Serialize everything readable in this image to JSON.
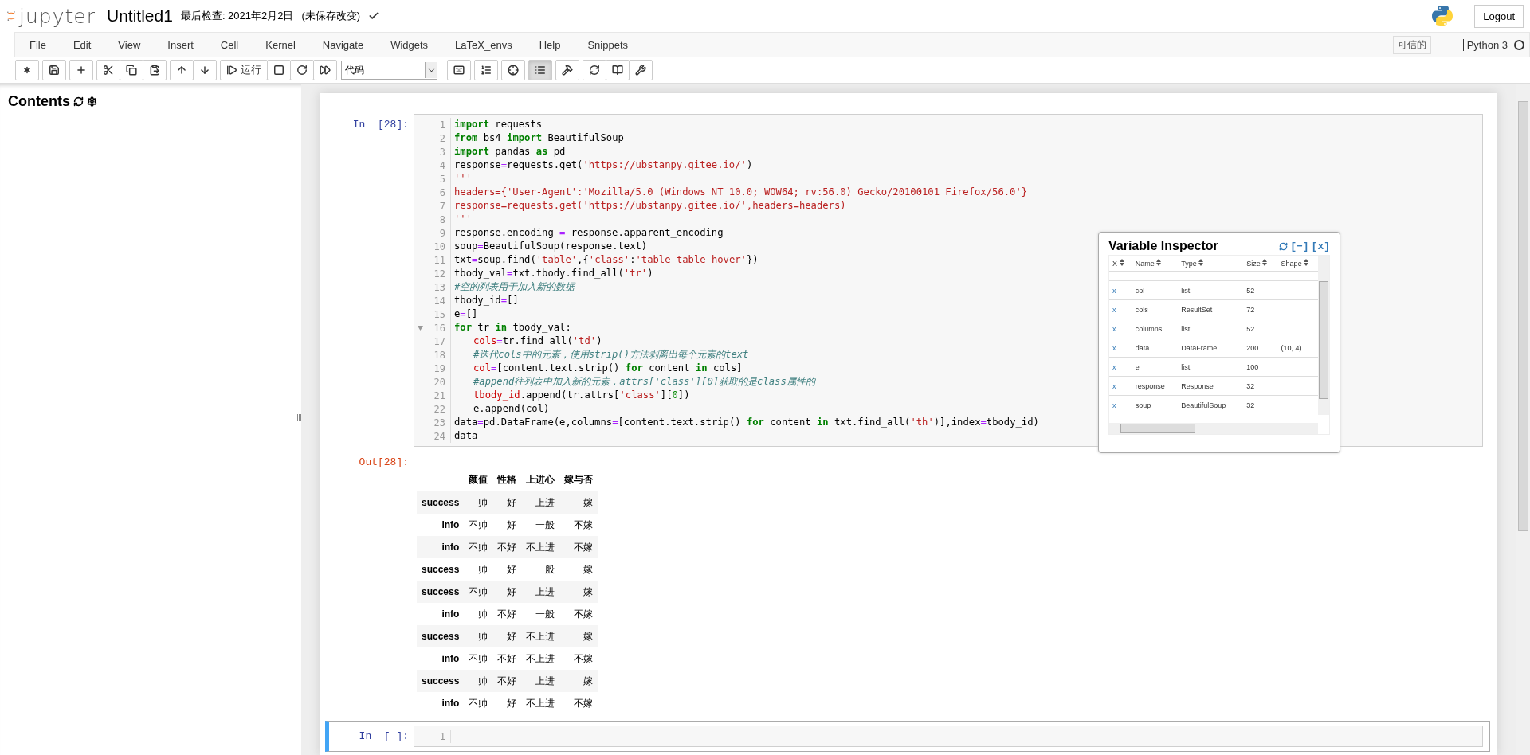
{
  "header": {
    "logo_text": "jupyter",
    "notebook_name": "Untitled1",
    "checkpoint": "最后检查: 2021年2月2日",
    "save_status": "(未保存改变)",
    "saved_mark": true,
    "logout": "Logout"
  },
  "menubar": {
    "items": [
      "File",
      "Edit",
      "View",
      "Insert",
      "Cell",
      "Kernel",
      "Navigate",
      "Widgets",
      "LaTeX_envs",
      "Help",
      "Snippets"
    ],
    "trusted": "可信的",
    "kernel": "Python 3",
    "kernel_busy": false
  },
  "toolbar": {
    "run_label": "运行",
    "cell_type": "代码",
    "toc_button_pressed": true
  },
  "sidebar": {
    "title": "Contents"
  },
  "cells": [
    {
      "prompt": "In  [28]:",
      "selected": false,
      "lines": [
        {
          "number": "1",
          "foldable": false,
          "tokens": [
            {
              "kind": "kw",
              "text": "import"
            },
            {
              "kind": "plain",
              "text": " requests"
            }
          ]
        },
        {
          "number": "2",
          "foldable": false,
          "tokens": [
            {
              "kind": "kw",
              "text": "from"
            },
            {
              "kind": "plain",
              "text": " bs4 "
            },
            {
              "kind": "kw",
              "text": "import"
            },
            {
              "kind": "plain",
              "text": " BeautifulSoup"
            }
          ]
        },
        {
          "number": "3",
          "foldable": false,
          "tokens": [
            {
              "kind": "kw",
              "text": "import"
            },
            {
              "kind": "plain",
              "text": " pandas "
            },
            {
              "kind": "kw",
              "text": "as"
            },
            {
              "kind": "plain",
              "text": " pd"
            }
          ]
        },
        {
          "number": "4",
          "foldable": false,
          "tokens": [
            {
              "kind": "plain",
              "text": "response"
            },
            {
              "kind": "op",
              "text": "="
            },
            {
              "kind": "plain",
              "text": "requests.get("
            },
            {
              "kind": "str",
              "text": "'https://ubstanpy.gitee.io/'"
            },
            {
              "kind": "plain",
              "text": ")"
            }
          ]
        },
        {
          "number": "5",
          "foldable": false,
          "tokens": [
            {
              "kind": "str",
              "text": "'''"
            }
          ]
        },
        {
          "number": "6",
          "foldable": false,
          "tokens": [
            {
              "kind": "str",
              "text": "headers={'User-Agent':'Mozilla/5.0 (Windows NT 10.0; WOW64; rv:56.0) Gecko/20100101 Firefox/56.0'}"
            }
          ]
        },
        {
          "number": "7",
          "foldable": false,
          "tokens": [
            {
              "kind": "str",
              "text": "response=requests.get('https://ubstanpy.gitee.io/',headers=headers)"
            }
          ]
        },
        {
          "number": "8",
          "foldable": false,
          "tokens": [
            {
              "kind": "str",
              "text": "'''"
            }
          ]
        },
        {
          "number": "9",
          "foldable": false,
          "tokens": [
            {
              "kind": "plain",
              "text": "response.encoding "
            },
            {
              "kind": "op",
              "text": "="
            },
            {
              "kind": "plain",
              "text": " response.apparent_encoding"
            }
          ]
        },
        {
          "number": "10",
          "foldable": false,
          "tokens": [
            {
              "kind": "plain",
              "text": "soup"
            },
            {
              "kind": "op",
              "text": "="
            },
            {
              "kind": "plain",
              "text": "BeautifulSoup(response.text)"
            }
          ]
        },
        {
          "number": "11",
          "foldable": false,
          "tokens": [
            {
              "kind": "plain",
              "text": "txt"
            },
            {
              "kind": "op",
              "text": "="
            },
            {
              "kind": "plain",
              "text": "soup.find("
            },
            {
              "kind": "str",
              "text": "'table'"
            },
            {
              "kind": "plain",
              "text": ",{"
            },
            {
              "kind": "str",
              "text": "'class'"
            },
            {
              "kind": "plain",
              "text": ":"
            },
            {
              "kind": "str",
              "text": "'table table-hover'"
            },
            {
              "kind": "plain",
              "text": "})"
            }
          ]
        },
        {
          "number": "12",
          "foldable": false,
          "tokens": [
            {
              "kind": "plain",
              "text": "tbody_val"
            },
            {
              "kind": "op",
              "text": "="
            },
            {
              "kind": "plain",
              "text": "txt.tbody.find_all("
            },
            {
              "kind": "str",
              "text": "'tr'"
            },
            {
              "kind": "plain",
              "text": ")"
            }
          ]
        },
        {
          "number": "13",
          "foldable": false,
          "tokens": [
            {
              "kind": "comment",
              "text": "#空的列表用于加入新的数据"
            }
          ]
        },
        {
          "number": "14",
          "foldable": false,
          "tokens": [
            {
              "kind": "plain",
              "text": "tbody_id"
            },
            {
              "kind": "op",
              "text": "="
            },
            {
              "kind": "plain",
              "text": "[]"
            }
          ]
        },
        {
          "number": "15",
          "foldable": false,
          "tokens": [
            {
              "kind": "plain",
              "text": "e"
            },
            {
              "kind": "op",
              "text": "="
            },
            {
              "kind": "plain",
              "text": "[]"
            }
          ]
        },
        {
          "number": "16",
          "foldable": true,
          "tokens": [
            {
              "kind": "kw",
              "text": "for"
            },
            {
              "kind": "plain",
              "text": " tr "
            },
            {
              "kind": "kw",
              "text": "in"
            },
            {
              "kind": "plain",
              "text": " tbody_val:"
            }
          ]
        },
        {
          "number": "17",
          "foldable": false,
          "indented": true,
          "tokens": [
            {
              "kind": "var",
              "text": "cols"
            },
            {
              "kind": "op",
              "text": "="
            },
            {
              "kind": "plain",
              "text": "tr.find_all("
            },
            {
              "kind": "str",
              "text": "'td'"
            },
            {
              "kind": "plain",
              "text": ")"
            }
          ]
        },
        {
          "number": "18",
          "foldable": false,
          "indented": true,
          "tokens": [
            {
              "kind": "comment",
              "text": "#迭代cols中的元素，使用strip()方法剥离出每个元素的text"
            }
          ]
        },
        {
          "number": "19",
          "foldable": false,
          "indented": true,
          "tokens": [
            {
              "kind": "var",
              "text": "col"
            },
            {
              "kind": "op",
              "text": "="
            },
            {
              "kind": "plain",
              "text": "[content.text.strip() "
            },
            {
              "kind": "kw",
              "text": "for"
            },
            {
              "kind": "plain",
              "text": " content "
            },
            {
              "kind": "kw",
              "text": "in"
            },
            {
              "kind": "plain",
              "text": " cols]"
            }
          ]
        },
        {
          "number": "20",
          "foldable": false,
          "indented": true,
          "tokens": [
            {
              "kind": "comment",
              "text": "#append往列表中加入新的元素，attrs['class'][0]获取的是class属性的"
            }
          ]
        },
        {
          "number": "21",
          "foldable": false,
          "indented": true,
          "tokens": [
            {
              "kind": "var",
              "text": "tbody_id"
            },
            {
              "kind": "plain",
              "text": ".append(tr.attrs["
            },
            {
              "kind": "str",
              "text": "'class'"
            },
            {
              "kind": "plain",
              "text": "]["
            },
            {
              "kind": "num",
              "text": "0"
            },
            {
              "kind": "plain",
              "text": "])"
            }
          ]
        },
        {
          "number": "22",
          "foldable": false,
          "indented": true,
          "tokens": [
            {
              "kind": "plain",
              "text": "e.append(col)"
            }
          ]
        },
        {
          "number": "23",
          "foldable": false,
          "tokens": [
            {
              "kind": "plain",
              "text": "data"
            },
            {
              "kind": "op",
              "text": "="
            },
            {
              "kind": "plain",
              "text": "pd.DataFrame(e,columns"
            },
            {
              "kind": "op",
              "text": "="
            },
            {
              "kind": "plain",
              "text": "[content.text.strip() "
            },
            {
              "kind": "kw",
              "text": "for"
            },
            {
              "kind": "plain",
              "text": " content "
            },
            {
              "kind": "kw",
              "text": "in"
            },
            {
              "kind": "plain",
              "text": " txt.find_all("
            },
            {
              "kind": "str",
              "text": "'th'"
            },
            {
              "kind": "plain",
              "text": ")],index"
            },
            {
              "kind": "op",
              "text": "="
            },
            {
              "kind": "plain",
              "text": "tbody_id)"
            }
          ]
        },
        {
          "number": "24",
          "foldable": false,
          "tokens": [
            {
              "kind": "plain",
              "text": "data"
            }
          ]
        }
      ],
      "output": {
        "prompt": "Out[28]:",
        "columns": [
          "颜值",
          "性格",
          "上进心",
          "嫁与否"
        ],
        "rows": [
          {
            "index": "success",
            "values": [
              "帅",
              "好",
              "上进",
              "嫁"
            ]
          },
          {
            "index": "info",
            "values": [
              "不帅",
              "好",
              "一般",
              "不嫁"
            ]
          },
          {
            "index": "info",
            "values": [
              "不帅",
              "不好",
              "不上进",
              "不嫁"
            ]
          },
          {
            "index": "success",
            "values": [
              "帅",
              "好",
              "一般",
              "嫁"
            ]
          },
          {
            "index": "success",
            "values": [
              "不帅",
              "好",
              "上进",
              "嫁"
            ]
          },
          {
            "index": "info",
            "values": [
              "帅",
              "不好",
              "一般",
              "不嫁"
            ]
          },
          {
            "index": "success",
            "values": [
              "帅",
              "好",
              "不上进",
              "嫁"
            ]
          },
          {
            "index": "info",
            "values": [
              "不帅",
              "不好",
              "不上进",
              "不嫁"
            ]
          },
          {
            "index": "success",
            "values": [
              "帅",
              "不好",
              "上进",
              "嫁"
            ]
          },
          {
            "index": "info",
            "values": [
              "不帅",
              "好",
              "不上进",
              "不嫁"
            ]
          }
        ]
      }
    },
    {
      "prompt": "In  [ ]:",
      "selected": true,
      "lines": [
        {
          "number": "1",
          "foldable": false
        }
      ]
    }
  ],
  "variable_inspector": {
    "title": "Variable Inspector",
    "collapse": "[−]",
    "close": "[x]",
    "columns": [
      "X",
      "Name",
      "Type",
      "Size",
      "Shape"
    ],
    "rows": [
      {
        "delete": "x",
        "name": "col",
        "type": "list",
        "size": "52"
      },
      {
        "delete": "x",
        "name": "cols",
        "type": "ResultSet",
        "size": "72"
      },
      {
        "delete": "x",
        "name": "columns",
        "type": "list",
        "size": "52"
      },
      {
        "delete": "x",
        "name": "data",
        "type": "DataFrame",
        "size": "200",
        "shape": "(10, 4)"
      },
      {
        "delete": "x",
        "name": "e",
        "type": "list",
        "size": "100"
      },
      {
        "delete": "x",
        "name": "response",
        "type": "Response",
        "size": "32"
      },
      {
        "delete": "x",
        "name": "soup",
        "type": "BeautifulSoup",
        "size": "32"
      }
    ]
  }
}
